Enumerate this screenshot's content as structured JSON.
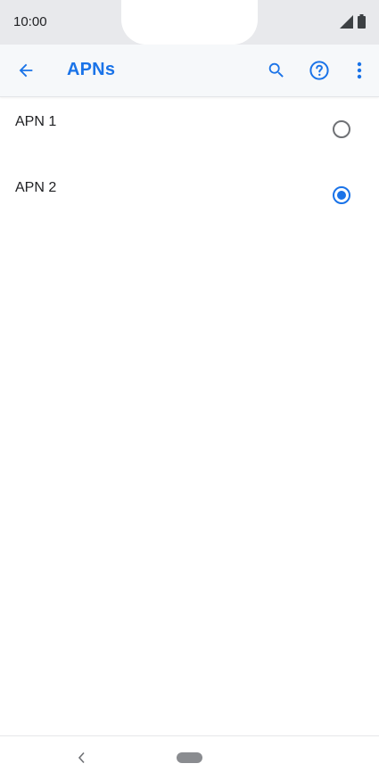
{
  "status_bar": {
    "time": "10:00",
    "icons": [
      "cellular-signal-icon",
      "battery-icon"
    ]
  },
  "app_bar": {
    "title": "APNs",
    "back_icon": "arrow-back-icon",
    "actions": [
      "search-icon",
      "help-icon",
      "more-vert-icon"
    ],
    "accent_color": "#1a73e8"
  },
  "apns": [
    {
      "label": "APN 1",
      "selected": false
    },
    {
      "label": "APN 2",
      "selected": true
    }
  ],
  "nav_bar": {
    "icons": [
      "nav-back-icon",
      "home-pill-icon"
    ]
  }
}
